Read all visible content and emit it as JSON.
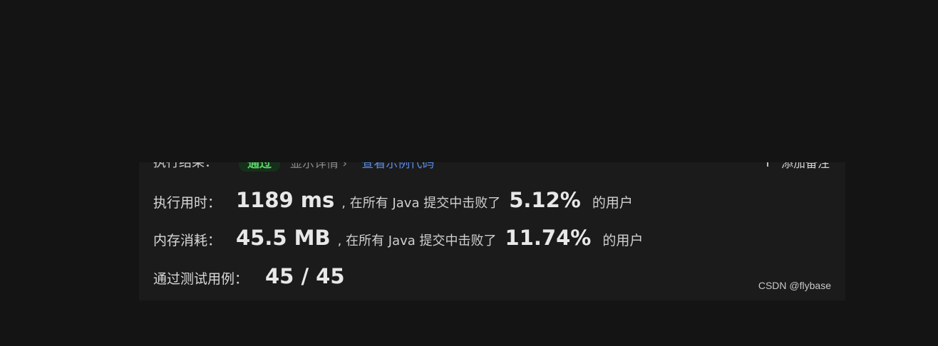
{
  "result": {
    "label": "执行结果：",
    "status": "通过",
    "show_details": "显示详情 ›",
    "view_example": "查看示例代码",
    "add_note": "添加备注"
  },
  "runtime": {
    "label": "执行用时：",
    "value": "1189 ms",
    "text": ", 在所有 Java 提交中击败了",
    "percent": "5.12%",
    "suffix": "的用户"
  },
  "memory": {
    "label": "内存消耗：",
    "value": "45.5 MB",
    "text": ", 在所有 Java 提交中击败了",
    "percent": "11.74%",
    "suffix": "的用户"
  },
  "tests": {
    "label": "通过测试用例：",
    "value": "45 / 45"
  },
  "watermark": "CSDN @flybase",
  "colors": {
    "background": "#141414",
    "panel": "#1b1b1b",
    "pass_green": "#5dd36a",
    "link_blue": "#5b8ee6"
  }
}
